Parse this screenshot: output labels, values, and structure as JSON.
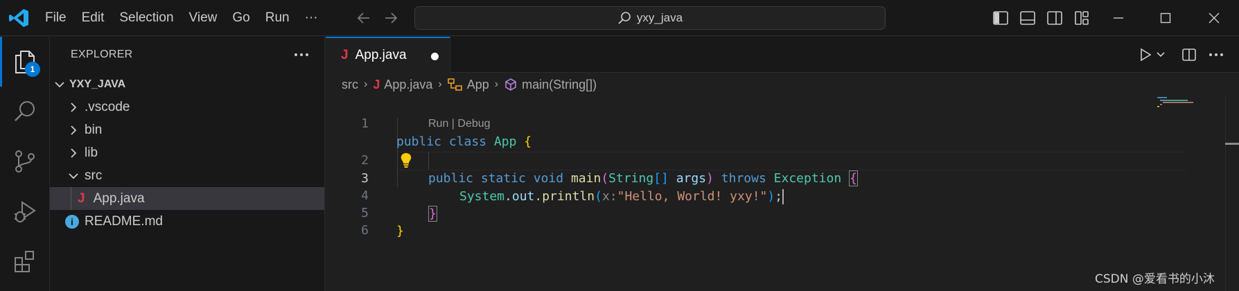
{
  "menu": [
    "File",
    "Edit",
    "Selection",
    "View",
    "Go",
    "Run",
    "···"
  ],
  "search": {
    "text": "yxy_java"
  },
  "activity": {
    "explorer_badge": "1"
  },
  "explorer": {
    "title": "EXPLORER",
    "more": "···",
    "root": "YXY_JAVA",
    "items": [
      {
        "label": ".vscode",
        "kind": "folder"
      },
      {
        "label": "bin",
        "kind": "folder"
      },
      {
        "label": "lib",
        "kind": "folder"
      },
      {
        "label": "src",
        "kind": "folder-open"
      },
      {
        "label": "App.java",
        "kind": "java-file"
      },
      {
        "label": "README.md",
        "kind": "info-file"
      }
    ]
  },
  "tab": {
    "label": "App.java",
    "icon": "J",
    "dirty": true
  },
  "breadcrumb": [
    "src",
    "App.java",
    "App",
    "main(String[])"
  ],
  "codelens": "Run | Debug",
  "line_numbers": [
    "1",
    "2",
    "3",
    "4",
    "5",
    "6"
  ],
  "code": {
    "l1": {
      "kw1": "public",
      "kw2": "class",
      "cls": "App",
      "brace": "{"
    },
    "l2": {
      "kw1": "public",
      "kw2": "static",
      "kw3": "void",
      "fn": "main",
      "paren_open": "(",
      "type": "String",
      "arr": "[]",
      "arg": "args",
      "paren_close": ")",
      "kw4": "throws",
      "exc": "Exception",
      "brace": "{"
    },
    "l3": {
      "obj": "System",
      "dot1": ".",
      "field": "out",
      "dot2": ".",
      "fn": "println",
      "paren_open": "(",
      "hint": "x:",
      "str": "\"Hello, World! yxy!\"",
      "paren_close": ")",
      "semi": ";"
    },
    "l4": {
      "brace": "}"
    },
    "l5": {
      "brace": "}"
    }
  },
  "watermark": "CSDN @爱看书的小沐",
  "colors": {
    "accent": "#0078d4",
    "java": "#e0384d",
    "keyword": "#569cd6",
    "class": "#4ec9b0",
    "function": "#dcdcaa",
    "string": "#ce9178"
  }
}
